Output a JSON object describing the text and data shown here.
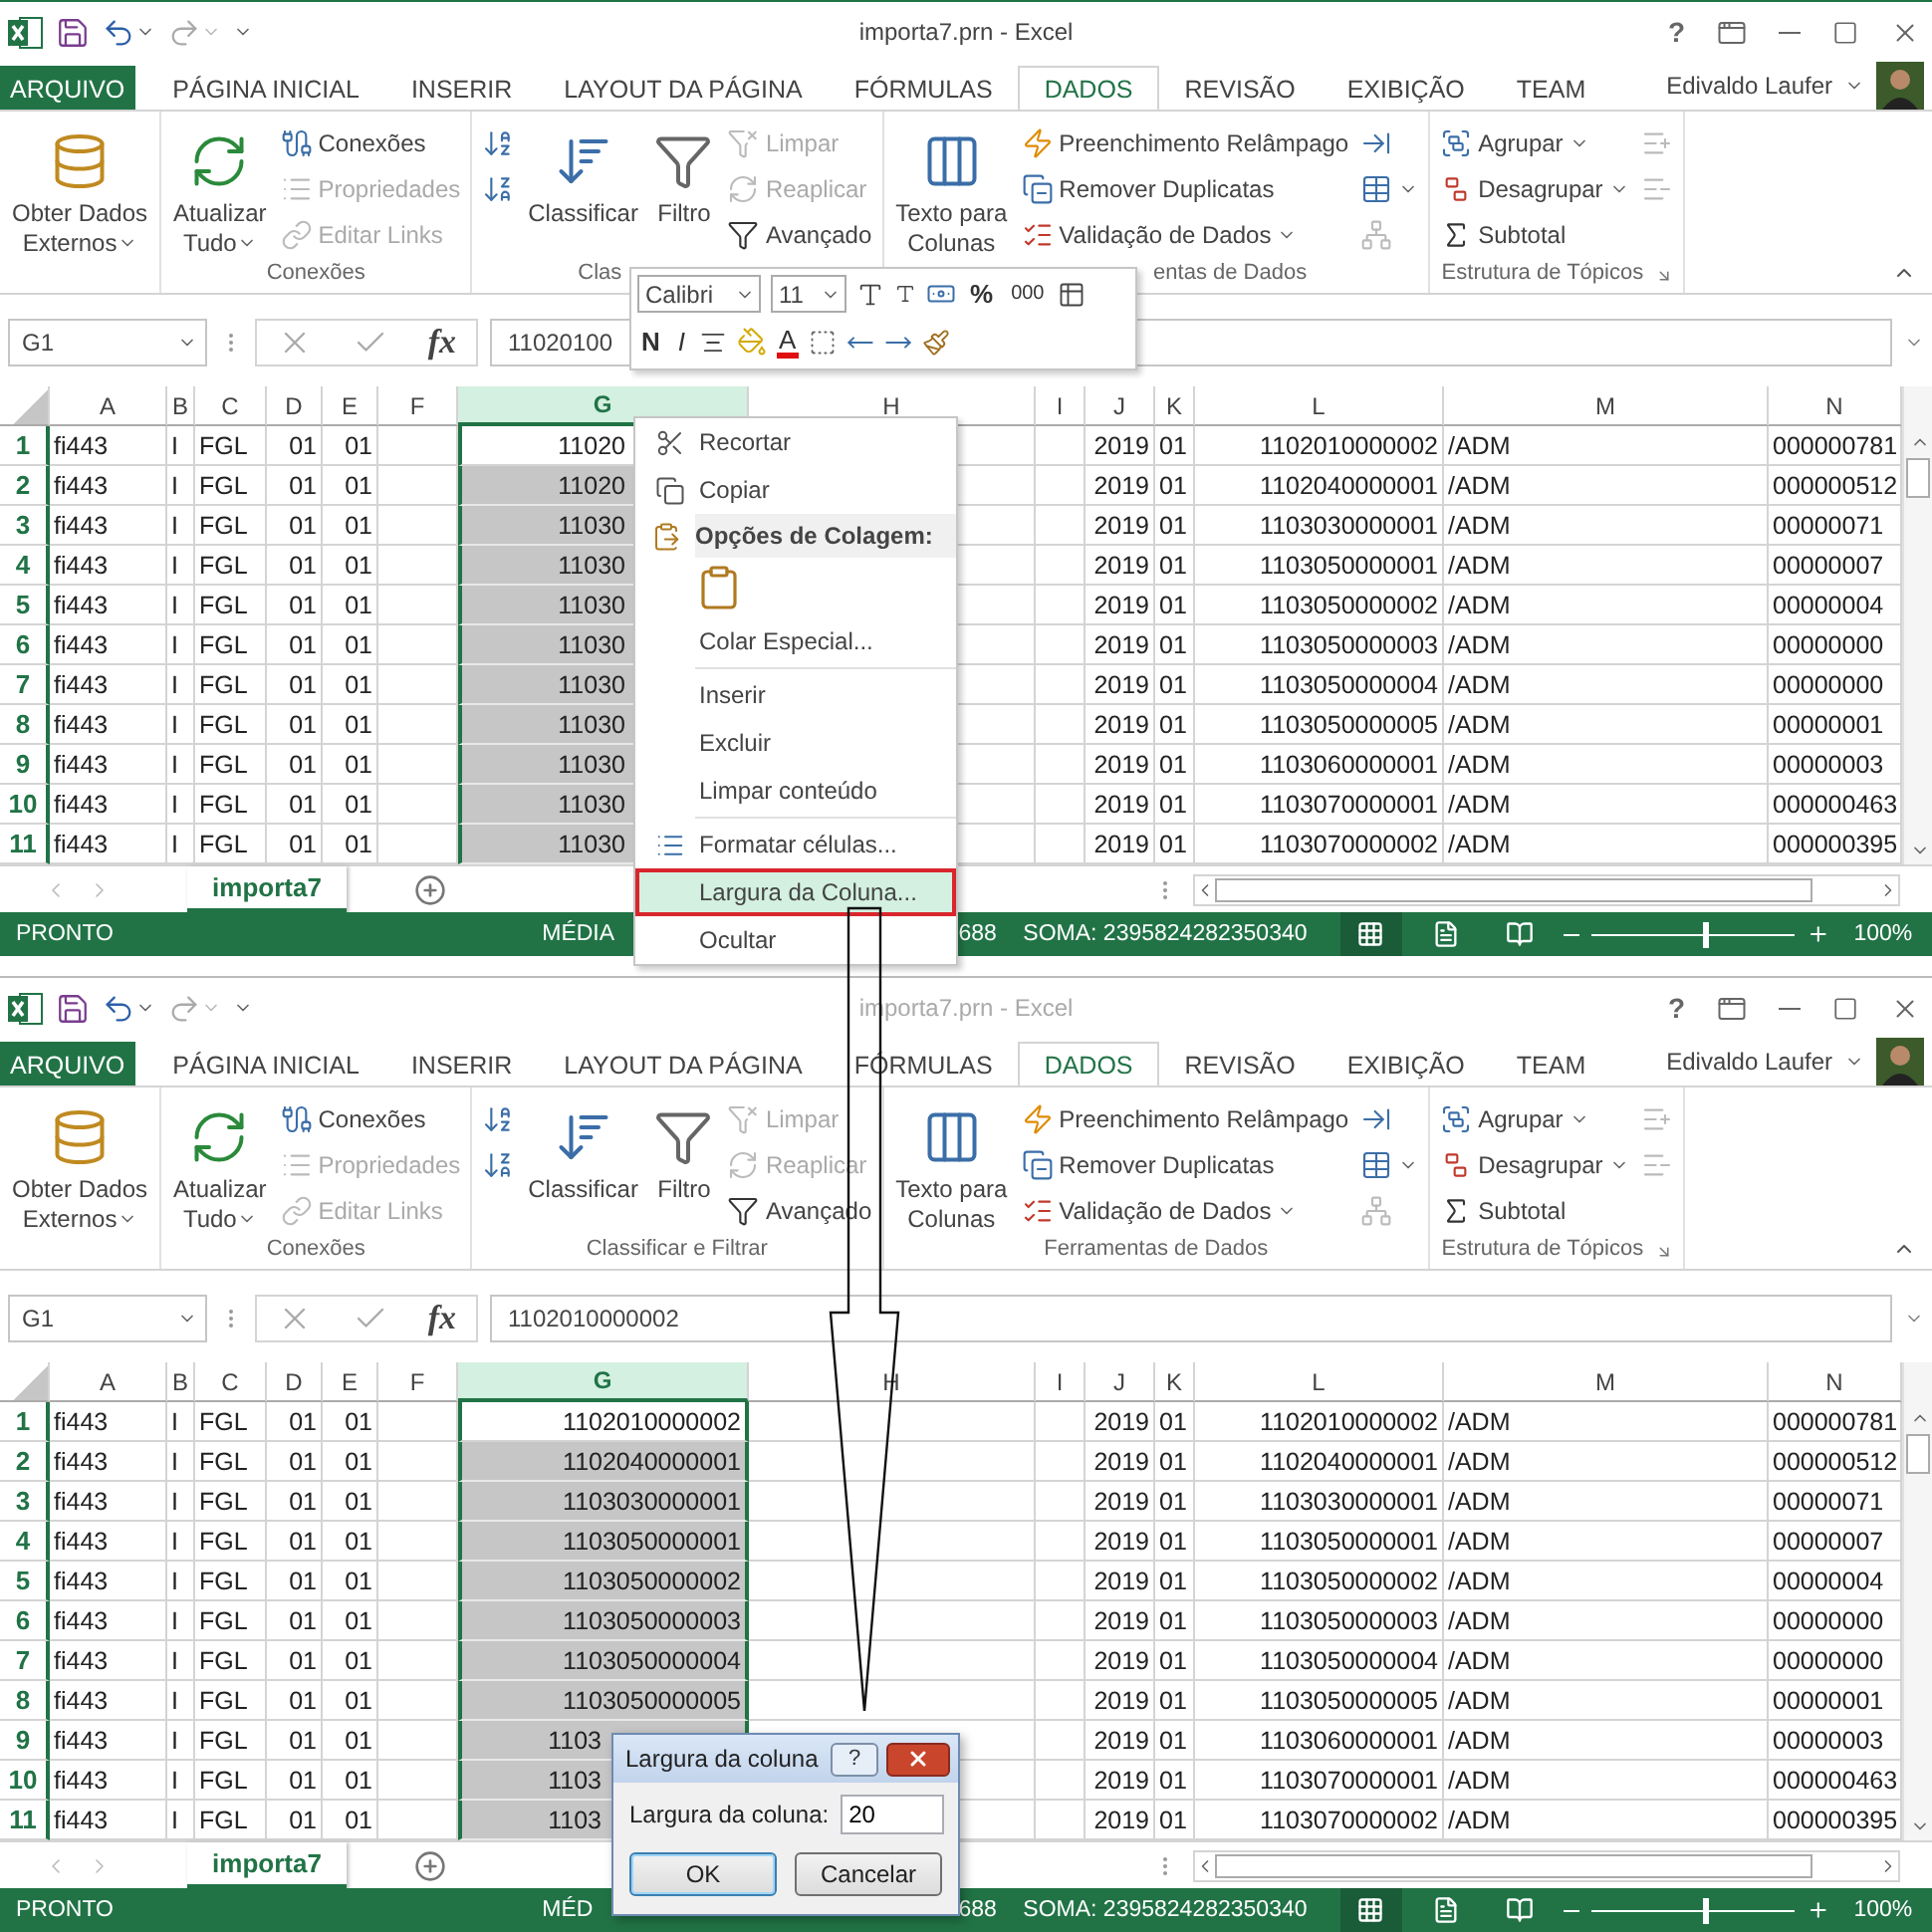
{
  "windows": [
    {
      "title": "importa7.prn - Excel",
      "active": true,
      "help": "?",
      "tabs": [
        {
          "label": "ARQUIVO",
          "kind": "file",
          "selected": false
        },
        {
          "label": "PÁGINA INICIAL",
          "kind": "tab",
          "selected": false
        },
        {
          "label": "INSERIR",
          "kind": "tab",
          "selected": false
        },
        {
          "label": "LAYOUT DA PÁGINA",
          "kind": "tab",
          "selected": false
        },
        {
          "label": "FÓRMULAS",
          "kind": "tab",
          "selected": false
        },
        {
          "label": "DADOS",
          "kind": "tab",
          "selected": true
        },
        {
          "label": "REVISÃO",
          "kind": "tab",
          "selected": false
        },
        {
          "label": "EXIBIÇÃO",
          "kind": "tab",
          "selected": false
        },
        {
          "label": "TEAM",
          "kind": "tab",
          "selected": false
        }
      ],
      "user": "Edivaldo Laufer",
      "ribbon": {
        "groups": [
          {
            "columns": [
              {
                "kind": "large",
                "lines": [
                  "Obter Dados",
                  "Externos"
                ],
                "dropdown": true
              }
            ]
          },
          {
            "label": "Conexões",
            "columns": [
              {
                "kind": "large",
                "lines": [
                  "Atualizar",
                  "Tudo"
                ],
                "dropdown": true
              },
              {
                "kind": "stack",
                "items": [
                  {
                    "label": "Conexões",
                    "disabled": false
                  },
                  {
                    "label": "Propriedades",
                    "disabled": true
                  },
                  {
                    "label": "Editar Links",
                    "disabled": true
                  }
                ]
              }
            ]
          },
          {
            "label": "Clas",
            "columns": [
              {
                "kind": "stack",
                "items": [
                  {
                    "disabled": false
                  },
                  {
                    "disabled": false
                  }
                ]
              },
              {
                "kind": "large",
                "lines": [
                  "Classificar"
                ]
              },
              {
                "kind": "large",
                "lines": [
                  "Filtro"
                ]
              },
              {
                "kind": "stack",
                "items": [
                  {
                    "label": "Limpar",
                    "disabled": true
                  },
                  {
                    "label": "Reaplicar",
                    "disabled": true
                  },
                  {
                    "label": "Avançado",
                    "disabled": false
                  }
                ]
              }
            ]
          },
          {
            "label": "entas de Dados",
            "columns": [
              {
                "kind": "large",
                "lines": [
                  "Texto para",
                  "Colunas"
                ]
              },
              {
                "kind": "stack",
                "items": [
                  {
                    "label": "Preenchimento Relâmpago",
                    "disabled": false
                  },
                  {
                    "label": "Remover Duplicatas",
                    "disabled": false
                  },
                  {
                    "label": "Validação de Dados",
                    "disabled": false,
                    "dropdown": true
                  }
                ]
              },
              {
                "kind": "stack",
                "items": [
                  {
                    "disabled": false
                  },
                  {
                    "disabled": false,
                    "dropdown": true
                  },
                  {
                    "disabled": true
                  }
                ]
              }
            ]
          },
          {
            "label": "Estrutura de Tópicos",
            "columns": [
              {
                "kind": "stack",
                "items": [
                  {
                    "label": "Agrupar",
                    "disabled": false,
                    "dropdown": true
                  },
                  {
                    "label": "Desagrupar",
                    "disabled": false,
                    "dropdown": true
                  },
                  {
                    "label": "Subtotal",
                    "disabled": false
                  }
                ]
              },
              {
                "kind": "stack",
                "items": [
                  {
                    "disabled": true
                  },
                  {
                    "disabled": true
                  }
                ]
              }
            ]
          }
        ]
      },
      "name_box": "G1",
      "fx": "fx",
      "formula": "11020100",
      "columns": [
        {
          "label": "A",
          "selected": false
        },
        {
          "label": "B",
          "selected": false
        },
        {
          "label": "C",
          "selected": false
        },
        {
          "label": "D",
          "selected": false
        },
        {
          "label": "E",
          "selected": false
        },
        {
          "label": "F",
          "selected": false
        },
        {
          "label": "G",
          "selected": true
        },
        {
          "label": "H",
          "selected": false
        },
        {
          "label": "I",
          "selected": false
        },
        {
          "label": "J",
          "selected": false
        },
        {
          "label": "K",
          "selected": false
        },
        {
          "label": "L",
          "selected": false
        },
        {
          "label": "M",
          "selected": false
        },
        {
          "label": "N",
          "selected": false
        }
      ],
      "rows": [
        {
          "n": "1",
          "cells": [
            "fi443",
            "I",
            "FGL",
            "01",
            "01",
            null,
            "11020",
            null,
            null,
            "2019",
            "01",
            "1102010000002",
            "/ADM",
            "000000781"
          ]
        },
        {
          "n": "2",
          "cells": [
            "fi443",
            "I",
            "FGL",
            "01",
            "01",
            null,
            "11020",
            null,
            null,
            "2019",
            "01",
            "1102040000001",
            "/ADM",
            "000000512"
          ]
        },
        {
          "n": "3",
          "cells": [
            "fi443",
            "I",
            "FGL",
            "01",
            "01",
            null,
            "11030",
            null,
            null,
            "2019",
            "01",
            "1103030000001",
            "/ADM",
            "00000071"
          ]
        },
        {
          "n": "4",
          "cells": [
            "fi443",
            "I",
            "FGL",
            "01",
            "01",
            null,
            "11030",
            null,
            null,
            "2019",
            "01",
            "1103050000001",
            "/ADM",
            "00000007"
          ]
        },
        {
          "n": "5",
          "cells": [
            "fi443",
            "I",
            "FGL",
            "01",
            "01",
            null,
            "11030",
            null,
            null,
            "2019",
            "01",
            "1103050000002",
            "/ADM",
            "00000004"
          ]
        },
        {
          "n": "6",
          "cells": [
            "fi443",
            "I",
            "FGL",
            "01",
            "01",
            null,
            "11030",
            null,
            null,
            "2019",
            "01",
            "1103050000003",
            "/ADM",
            "00000000"
          ]
        },
        {
          "n": "7",
          "cells": [
            "fi443",
            "I",
            "FGL",
            "01",
            "01",
            null,
            "11030",
            null,
            null,
            "2019",
            "01",
            "1103050000004",
            "/ADM",
            "00000000"
          ]
        },
        {
          "n": "8",
          "cells": [
            "fi443",
            "I",
            "FGL",
            "01",
            "01",
            null,
            "11030",
            null,
            null,
            "2019",
            "01",
            "1103050000005",
            "/ADM",
            "00000001"
          ]
        },
        {
          "n": "9",
          "cells": [
            "fi443",
            "I",
            "FGL",
            "01",
            "01",
            null,
            "11030",
            null,
            null,
            "2019",
            "01",
            "1103060000001",
            "/ADM",
            "00000003"
          ]
        },
        {
          "n": "10",
          "cells": [
            "fi443",
            "I",
            "FGL",
            "01",
            "01",
            null,
            "11030",
            null,
            null,
            "2019",
            "01",
            "1103070000001",
            "/ADM",
            "000000463"
          ]
        },
        {
          "n": "11",
          "cells": [
            "fi443",
            "I",
            "FGL",
            "01",
            "01",
            null,
            "11030",
            null,
            null,
            "2019",
            "01",
            "1103070000002",
            "/ADM",
            "000000395"
          ]
        }
      ],
      "sheets": [
        {
          "label": "importa7",
          "selected": true
        }
      ],
      "status": {
        "state": "PRONTO",
        "average": "MÉDIA",
        "count": "688",
        "sum": "SOMA: 2395824282350340",
        "views": [
          {
            "selected": true
          },
          {
            "selected": false
          },
          {
            "selected": false
          }
        ],
        "zoom": {
          "level": 0.55,
          "reading": "100%"
        }
      },
      "mini_toolbar": {
        "font": "Calibri",
        "size": "11",
        "percent": "%",
        "thousands": "000",
        "bold": "N",
        "italic": "I",
        "font_color": "A"
      },
      "context_menu": {
        "items": [
          {
            "kind": "item",
            "label": "Recortar",
            "selected": false
          },
          {
            "kind": "item",
            "label": "Copiar",
            "selected": false
          },
          {
            "kind": "header",
            "label": "Opções de Colagem:"
          },
          {
            "kind": "paste"
          },
          {
            "kind": "item",
            "label": "Colar Especial...",
            "selected": false
          },
          {
            "kind": "separator"
          },
          {
            "kind": "item",
            "label": "Inserir",
            "selected": false
          },
          {
            "kind": "item",
            "label": "Excluir",
            "selected": false
          },
          {
            "kind": "item",
            "label": "Limpar conteúdo",
            "selected": false
          },
          {
            "kind": "separator"
          },
          {
            "kind": "item",
            "label": "Formatar células...",
            "selected": false
          },
          {
            "kind": "item",
            "label": "Largura da Coluna...",
            "selected": true
          },
          {
            "kind": "item",
            "label": "Ocultar",
            "selected": false
          }
        ]
      }
    },
    {
      "title": "importa7.prn - Excel",
      "active": false,
      "help": "?",
      "tabs": [
        {
          "label": "ARQUIVO",
          "kind": "file",
          "selected": false
        },
        {
          "label": "PÁGINA INICIAL",
          "kind": "tab",
          "selected": false
        },
        {
          "label": "INSERIR",
          "kind": "tab",
          "selected": false
        },
        {
          "label": "LAYOUT DA PÁGINA",
          "kind": "tab",
          "selected": false
        },
        {
          "label": "FÓRMULAS",
          "kind": "tab",
          "selected": false
        },
        {
          "label": "DADOS",
          "kind": "tab",
          "selected": true
        },
        {
          "label": "REVISÃO",
          "kind": "tab",
          "selected": false
        },
        {
          "label": "EXIBIÇÃO",
          "kind": "tab",
          "selected": false
        },
        {
          "label": "TEAM",
          "kind": "tab",
          "selected": false
        }
      ],
      "user": "Edivaldo Laufer",
      "ribbon": {
        "groups": [
          {
            "columns": [
              {
                "kind": "large",
                "lines": [
                  "Obter Dados",
                  "Externos"
                ],
                "dropdown": true
              }
            ]
          },
          {
            "label": "Conexões",
            "columns": [
              {
                "kind": "large",
                "lines": [
                  "Atualizar",
                  "Tudo"
                ],
                "dropdown": true
              },
              {
                "kind": "stack",
                "items": [
                  {
                    "label": "Conexões",
                    "disabled": false
                  },
                  {
                    "label": "Propriedades",
                    "disabled": true
                  },
                  {
                    "label": "Editar Links",
                    "disabled": true
                  }
                ]
              }
            ]
          },
          {
            "label": "Classificar e Filtrar",
            "columns": [
              {
                "kind": "stack",
                "items": [
                  {
                    "disabled": false
                  },
                  {
                    "disabled": false
                  }
                ]
              },
              {
                "kind": "large",
                "lines": [
                  "Classificar"
                ]
              },
              {
                "kind": "large",
                "lines": [
                  "Filtro"
                ]
              },
              {
                "kind": "stack",
                "items": [
                  {
                    "label": "Limpar",
                    "disabled": true
                  },
                  {
                    "label": "Reaplicar",
                    "disabled": true
                  },
                  {
                    "label": "Avançado",
                    "disabled": false
                  }
                ]
              }
            ]
          },
          {
            "label": "Ferramentas de Dados",
            "columns": [
              {
                "kind": "large",
                "lines": [
                  "Texto para",
                  "Colunas"
                ]
              },
              {
                "kind": "stack",
                "items": [
                  {
                    "label": "Preenchimento Relâmpago",
                    "disabled": false
                  },
                  {
                    "label": "Remover Duplicatas",
                    "disabled": false
                  },
                  {
                    "label": "Validação de Dados",
                    "disabled": false,
                    "dropdown": true
                  }
                ]
              },
              {
                "kind": "stack",
                "items": [
                  {
                    "disabled": false
                  },
                  {
                    "disabled": false,
                    "dropdown": true
                  },
                  {
                    "disabled": true
                  }
                ]
              }
            ]
          },
          {
            "label": "Estrutura de Tópicos",
            "columns": [
              {
                "kind": "stack",
                "items": [
                  {
                    "label": "Agrupar",
                    "disabled": false,
                    "dropdown": true
                  },
                  {
                    "label": "Desagrupar",
                    "disabled": false,
                    "dropdown": true
                  },
                  {
                    "label": "Subtotal",
                    "disabled": false
                  }
                ]
              },
              {
                "kind": "stack",
                "items": [
                  {
                    "disabled": true
                  },
                  {
                    "disabled": true
                  }
                ]
              }
            ]
          }
        ]
      },
      "name_box": "G1",
      "fx": "fx",
      "formula": "1102010000002",
      "columns": [
        {
          "label": "A",
          "selected": false
        },
        {
          "label": "B",
          "selected": false
        },
        {
          "label": "C",
          "selected": false
        },
        {
          "label": "D",
          "selected": false
        },
        {
          "label": "E",
          "selected": false
        },
        {
          "label": "F",
          "selected": false
        },
        {
          "label": "G",
          "selected": true
        },
        {
          "label": "H",
          "selected": false
        },
        {
          "label": "I",
          "selected": false
        },
        {
          "label": "J",
          "selected": false
        },
        {
          "label": "K",
          "selected": false
        },
        {
          "label": "L",
          "selected": false
        },
        {
          "label": "M",
          "selected": false
        },
        {
          "label": "N",
          "selected": false
        }
      ],
      "rows": [
        {
          "n": "1",
          "cells": [
            "fi443",
            "I",
            "FGL",
            "01",
            "01",
            null,
            "1102010000002",
            null,
            null,
            "2019",
            "01",
            "1102010000002",
            "/ADM",
            "000000781"
          ]
        },
        {
          "n": "2",
          "cells": [
            "fi443",
            "I",
            "FGL",
            "01",
            "01",
            null,
            "1102040000001",
            null,
            null,
            "2019",
            "01",
            "1102040000001",
            "/ADM",
            "000000512"
          ]
        },
        {
          "n": "3",
          "cells": [
            "fi443",
            "I",
            "FGL",
            "01",
            "01",
            null,
            "1103030000001",
            null,
            null,
            "2019",
            "01",
            "1103030000001",
            "/ADM",
            "00000071"
          ]
        },
        {
          "n": "4",
          "cells": [
            "fi443",
            "I",
            "FGL",
            "01",
            "01",
            null,
            "1103050000001",
            null,
            null,
            "2019",
            "01",
            "1103050000001",
            "/ADM",
            "00000007"
          ]
        },
        {
          "n": "5",
          "cells": [
            "fi443",
            "I",
            "FGL",
            "01",
            "01",
            null,
            "1103050000002",
            null,
            null,
            "2019",
            "01",
            "1103050000002",
            "/ADM",
            "00000004"
          ]
        },
        {
          "n": "6",
          "cells": [
            "fi443",
            "I",
            "FGL",
            "01",
            "01",
            null,
            "1103050000003",
            null,
            null,
            "2019",
            "01",
            "1103050000003",
            "/ADM",
            "00000000"
          ]
        },
        {
          "n": "7",
          "cells": [
            "fi443",
            "I",
            "FGL",
            "01",
            "01",
            null,
            "1103050000004",
            null,
            null,
            "2019",
            "01",
            "1103050000004",
            "/ADM",
            "00000000"
          ]
        },
        {
          "n": "8",
          "cells": [
            "fi443",
            "I",
            "FGL",
            "01",
            "01",
            null,
            "1103050000005",
            null,
            null,
            "2019",
            "01",
            "1103050000005",
            "/ADM",
            "00000001"
          ]
        },
        {
          "n": "9",
          "cells": [
            "fi443",
            "I",
            "FGL",
            "01",
            "01",
            null,
            "1103",
            null,
            null,
            "2019",
            "01",
            "1103060000001",
            "/ADM",
            "00000003"
          ]
        },
        {
          "n": "10",
          "cells": [
            "fi443",
            "I",
            "FGL",
            "01",
            "01",
            null,
            "1103",
            null,
            null,
            "2019",
            "01",
            "1103070000001",
            "/ADM",
            "000000463"
          ]
        },
        {
          "n": "11",
          "cells": [
            "fi443",
            "I",
            "FGL",
            "01",
            "01",
            null,
            "1103",
            null,
            null,
            "2019",
            "01",
            "1103070000002",
            "/ADM",
            "000000395"
          ]
        }
      ],
      "sheets": [
        {
          "label": "importa7",
          "selected": true
        }
      ],
      "status": {
        "state": "PRONTO",
        "average": "MÉD",
        "count": "688",
        "sum": "SOMA: 2395824282350340",
        "views": [
          {
            "selected": true
          },
          {
            "selected": false
          },
          {
            "selected": false
          }
        ],
        "zoom": {
          "level": 0.55,
          "reading": "100%"
        }
      },
      "dialog": {
        "title": "Largura da coluna",
        "help": "?",
        "label": "Largura da coluna:",
        "value": "20",
        "buttons": [
          {
            "label": "OK",
            "kind": "default"
          },
          {
            "label": "Cancelar",
            "kind": "normal"
          }
        ]
      }
    }
  ]
}
